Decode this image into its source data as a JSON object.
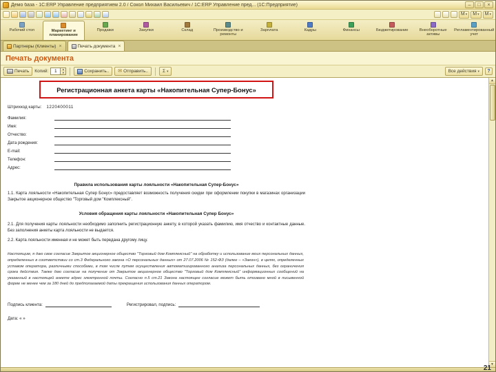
{
  "window": {
    "title": "Демо база - 1С:ERP Управление предприятием 2.0 / Сокол Михаил Васильевич / 1С:ERP Управление пред... (1С:Предприятие)",
    "minimize": "–",
    "restore": "□",
    "close": "×"
  },
  "menubar": {
    "icons": [
      "new-document",
      "open",
      "save",
      "print",
      "print-preview",
      "undo",
      "redo",
      "cut",
      "copy",
      "paste",
      "find",
      "calculator",
      "calendar"
    ],
    "right_icons": [
      "calculator",
      "calendar",
      "info"
    ],
    "right_buttons": [
      "M",
      "M",
      "M"
    ],
    "caret": "▾"
  },
  "ribbon": {
    "tabs": [
      {
        "label": "Рабочий стол"
      },
      {
        "label": "Маркетинг и планирование"
      },
      {
        "label": "Продажи"
      },
      {
        "label": "Закупки"
      },
      {
        "label": "Склад"
      },
      {
        "label": "Производство и ремонты"
      },
      {
        "label": "Зарплата"
      },
      {
        "label": "Кадры"
      },
      {
        "label": "Финансы"
      },
      {
        "label": "Бюджетирование"
      },
      {
        "label": "Внеоборотные активы"
      },
      {
        "label": "Регламентированный учет"
      }
    ]
  },
  "doc_tabs": [
    {
      "label": "Партнеры (Клиенты)",
      "close": "×"
    },
    {
      "label": "Печать документа",
      "close": "×"
    }
  ],
  "page_header": {
    "title": "Печать документа"
  },
  "toolbar": {
    "print": "Печать",
    "copies_label": "Копий:",
    "copies_value": "1",
    "spin_up": "▲",
    "spin_down": "▼",
    "save": "Сохранить..",
    "send": "Отправить..",
    "sum": "Σ",
    "all_actions": "Все действия",
    "caret": "▾",
    "help": "?"
  },
  "scrollbar": {
    "up": "▲",
    "down": "▼"
  },
  "document": {
    "title": "Регистрационная анкета карты «Накопительная Супер-Бонус»",
    "barcode_label": "Штрихкод карты:",
    "barcode_value": "1220400011",
    "fields": [
      {
        "label": "Фамилия:"
      },
      {
        "label": "Имя:"
      },
      {
        "label": "Отчество:"
      },
      {
        "label": "Дата рождения:"
      },
      {
        "label": "E-mail:"
      },
      {
        "label": "Телефон:"
      },
      {
        "label": "Адрес:"
      }
    ],
    "rules_heading": "Правила использования карты лояльности «Накопительная Супер-Бонус»",
    "rule_1_1": "1.1. Карта лояльности «Накопительная Супер Бонус» предоставляет возможность получения скидки при оформлении покупки в магазинах организации Закрытое акционерное общество \"Торговый дом \"Комплексный\".",
    "terms_heading": "Условия обращения карты лояльности «Накопительная Супер Бонус»",
    "term_2_1": "2.1. Для получения карты лояльности необходимо заполнить регистрационную анкету, в которой указать фамилию, имя отчество и контактные данные. Без заполнения анкеты карта лояльности не выдается.",
    "term_2_2": "2.2. Карта лояльности именная и не может быть передана другому лицу.",
    "consent": "Настоящим, я даю свое согласие Закрытое акционерное общество \"Торговый дом Комплексный\" на обработку и использование моих персональных данных, определенных в соответствии со ст.3 Федерального закона «О персональных данных» от 27.07.2006 № 152-ФЗ (далее – «Закон»), в целях, определенных уставом оператора, различными способами, в том числе путем осуществления автоматизированного анализа персональных данных, без ограничения срока действия. Также даю согласие на получение от Закрытое акционерное общество \"Торговый дом Комплексный\" информационных сообщений на указанный в настоящей анкете адрес электронной почты. Согласно п.5 ст.21 Закона настоящее согласие может быть отозвано мной в письменной форме не менее чем за 180 дней до предполагаемой даты прекращения использования данных оператором.",
    "signature_client_label": "Подпись клиента:",
    "signature_registrar_label": "Регистрировал, подпись:",
    "date_label": "Дата: «        »"
  },
  "slide_number": "21"
}
